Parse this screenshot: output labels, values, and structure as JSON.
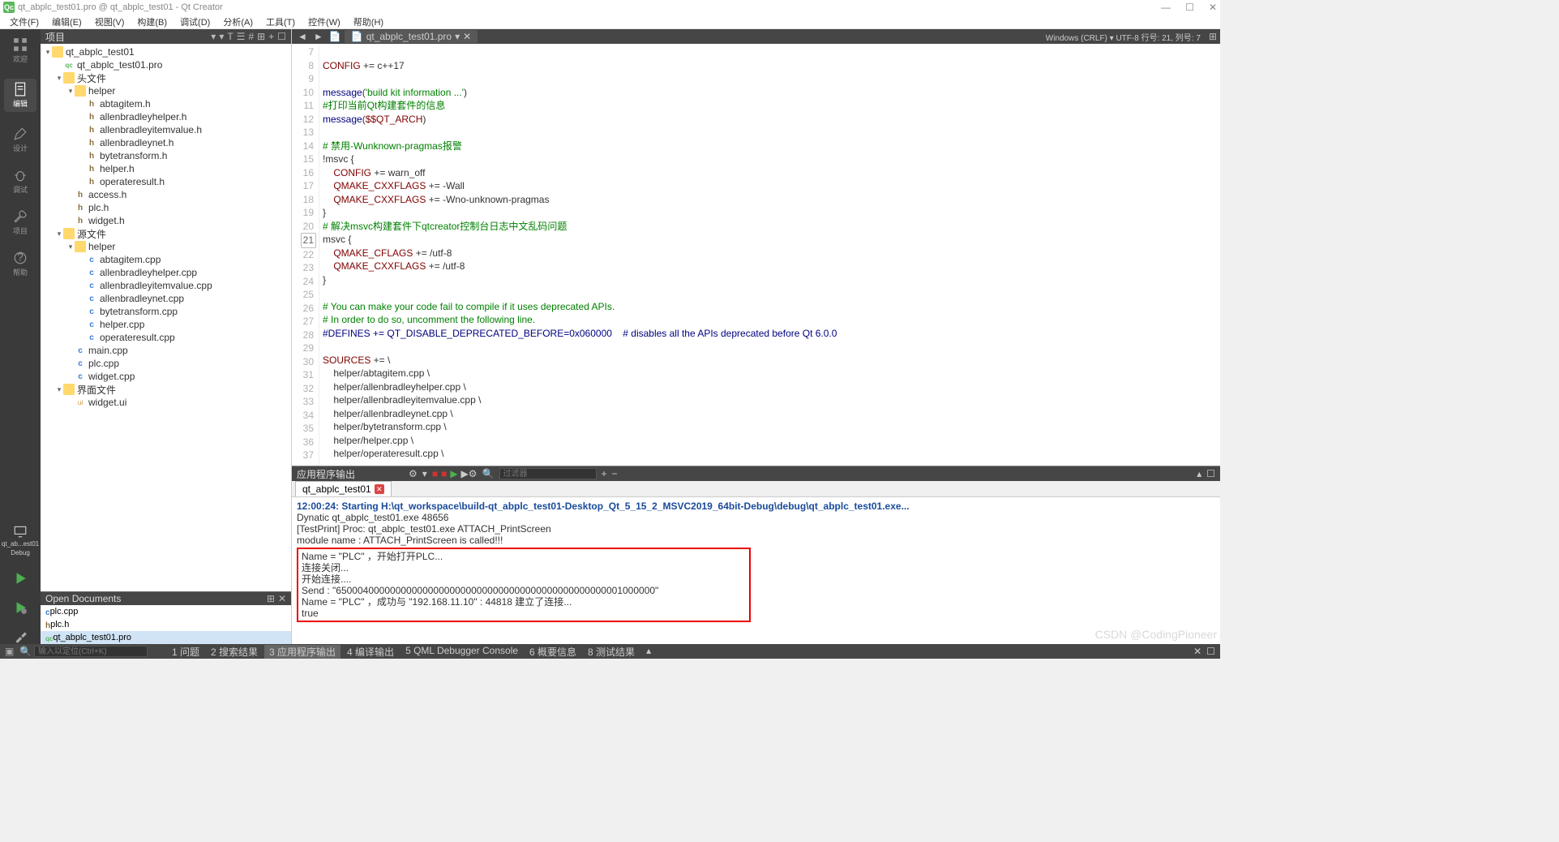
{
  "window": {
    "title": "qt_abplc_test01.pro @ qt_abplc_test01 - Qt Creator",
    "min": "—",
    "max": "☐",
    "close": "✕"
  },
  "menu": [
    "文件(F)",
    "编辑(E)",
    "视图(V)",
    "构建(B)",
    "调试(D)",
    "分析(A)",
    "工具(T)",
    "控件(W)",
    "帮助(H)"
  ],
  "activity": [
    {
      "label": "欢迎",
      "icon": "grid"
    },
    {
      "label": "编辑",
      "icon": "doc",
      "active": true
    },
    {
      "label": "设计",
      "icon": "pen"
    },
    {
      "label": "调试",
      "icon": "bug"
    },
    {
      "label": "项目",
      "icon": "wrench"
    },
    {
      "label": "帮助",
      "icon": "help"
    }
  ],
  "leftBadge1": "qt_ab...est01",
  "leftBadge2": "Debug",
  "sidebar": {
    "header": "项目",
    "tools": [
      "▾",
      "▾",
      "T",
      "☰",
      "#",
      "⊞",
      "+",
      "☐"
    ]
  },
  "tree": {
    "root": {
      "label": "qt_abplc_test01",
      "type": "project"
    },
    "pro": {
      "label": "qt_abplc_test01.pro",
      "type": "pro"
    },
    "headers": {
      "label": "头文件"
    },
    "helper_h": {
      "label": "helper"
    },
    "hfiles": [
      "abtagitem.h",
      "allenbradleyhelper.h",
      "allenbradleyitemvalue.h",
      "allenbradleynet.h",
      "bytetransform.h",
      "helper.h",
      "operateresult.h"
    ],
    "hroot": [
      "access.h",
      "plc.h",
      "widget.h"
    ],
    "sources": {
      "label": "源文件"
    },
    "helper_c": {
      "label": "helper"
    },
    "cfiles": [
      "abtagitem.cpp",
      "allenbradleyhelper.cpp",
      "allenbradleyitemvalue.cpp",
      "allenbradleynet.cpp",
      "bytetransform.cpp",
      "helper.cpp",
      "operateresult.cpp"
    ],
    "croot": [
      "main.cpp",
      "plc.cpp",
      "widget.cpp"
    ],
    "forms": {
      "label": "界面文件"
    },
    "uifiles": [
      "widget.ui"
    ]
  },
  "openDocs": {
    "header": "Open Documents",
    "items": [
      "plc.cpp",
      "plc.h",
      "qt_abplc_test01.pro"
    ],
    "active": 2
  },
  "editor": {
    "tab": "qt_abplc_test01.pro",
    "status": "Windows (CRLF)    ▾  UTF-8  行号: 21, 列号: 7",
    "startLine": 7,
    "highlightLine": 21,
    "lines": [
      "",
      "CONFIG += c++17",
      "",
      "message('build kit information ...')",
      "#打印当前Qt构建套件的信息",
      "message($$QT_ARCH)",
      "",
      "# 禁用-Wunknown-pragmas报警",
      "!msvc {",
      "    CONFIG += warn_off",
      "    QMAKE_CXXFLAGS += -Wall",
      "    QMAKE_CXXFLAGS += -Wno-unknown-pragmas",
      "}",
      "# 解决msvc构建套件下qtcreator控制台日志中文乱码问题",
      "msvc {",
      "    QMAKE_CFLAGS += /utf-8",
      "    QMAKE_CXXFLAGS += /utf-8",
      "}",
      "",
      "# You can make your code fail to compile if it uses deprecated APIs.",
      "# In order to do so, uncomment the following line.",
      "#DEFINES += QT_DISABLE_DEPRECATED_BEFORE=0x060000    # disables all the APIs deprecated before Qt 6.0.0",
      "",
      "SOURCES += \\",
      "    helper/abtagitem.cpp \\",
      "    helper/allenbradleyhelper.cpp \\",
      "    helper/allenbradleyitemvalue.cpp \\",
      "    helper/allenbradleynet.cpp \\",
      "    helper/bytetransform.cpp \\",
      "    helper/helper.cpp \\",
      "    helper/operateresult.cpp \\"
    ],
    "syntax": {
      "comments": [
        4,
        7,
        13,
        19,
        20,
        21
      ],
      "strings": [
        3
      ]
    }
  },
  "output": {
    "title": "应用程序输出",
    "filter": "过滤器",
    "tab": "qt_abplc_test01",
    "ts": "12:00:24: Starting H:\\qt_workspace\\build-qt_abplc_test01-Desktop_Qt_5_15_2_MSVC2019_64bit-Debug\\debug\\qt_abplc_test01.exe...",
    "plain": [
      "Dynatic qt_abplc_test01.exe 48656",
      "[TestPrint] Proc: qt_abplc_test01.exe ATTACH_PrintScreen",
      "module name : ATTACH_PrintScreen is called!!!"
    ],
    "boxed": [
      "Name =  \"PLC\" ，开始打开PLC...",
      "连接关闭...",
      "开始连接....",
      "Send :  \"65000400000000000000000000000000000000000000000000001000000\"",
      "Name =  \"PLC\" ，成功与 \"192.168.11.10\" : 44818 建立了连接...",
      "true"
    ]
  },
  "statusbar": {
    "placeholder": "输入以定位(Ctrl+K)",
    "items": [
      "1 问题",
      "2 搜索结果",
      "3 应用程序输出",
      "4 编译输出",
      "5 QML Debugger Console",
      "6 概要信息",
      "8 测试结果"
    ],
    "active": 2
  },
  "watermark": "CSDN @CodingPioneer"
}
